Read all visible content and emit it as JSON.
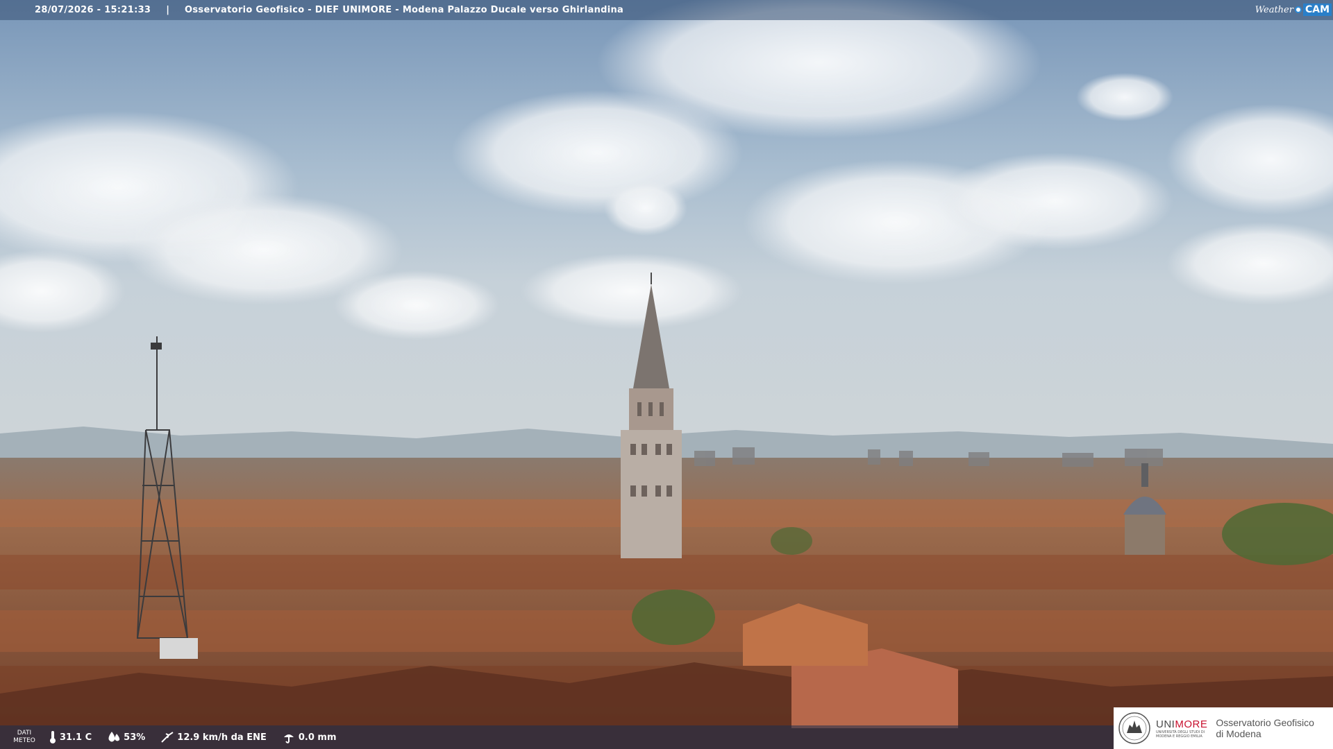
{
  "header": {
    "timestamp": "28/07/2026 - 15:21:33",
    "separator": "|",
    "title": "Osservatorio Geofisico - DIEF UNIMORE - Modena Palazzo Ducale verso Ghirlandina",
    "brand_weather": "Weather",
    "brand_cam": "CAM"
  },
  "footer": {
    "dati_label_1": "DATI",
    "dati_label_2": "METEO",
    "temperature": "31.1 C",
    "humidity": "53%",
    "wind": "12.9 km/h da ENE",
    "rain": "0.0 mm",
    "icons": [
      "thermometer-icon",
      "humidity-drop-icon",
      "wind-icon",
      "rain-icon"
    ]
  },
  "logo": {
    "unimore_part1": "UNI",
    "unimore_part2": "MORE",
    "unimore_sub1": "UNIVERSITÀ DEGLI STUDI DI",
    "unimore_sub2": "MODENA E REGGIO EMILIA",
    "osservatorio_line1": "Osservatorio Geofisico",
    "osservatorio_line2": "di Modena"
  },
  "colors": {
    "sky_top": "#7d9cbd",
    "sky_mid": "#b5c6d4",
    "haze": "#c8cfd4",
    "roofs": "#9c5a3a",
    "wc_blue": "#2a7fc9",
    "unimore_red": "#c8102e"
  }
}
